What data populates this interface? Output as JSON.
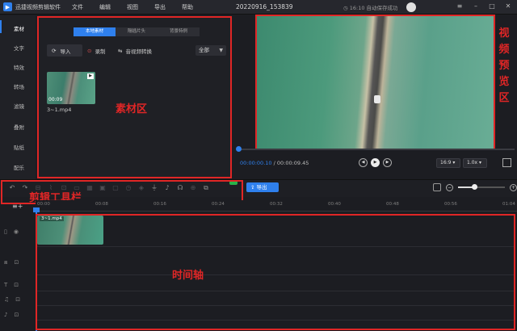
{
  "app": {
    "name": "迅捷视频剪辑软件",
    "document_title": "20220916_153839",
    "save_status": "16:10 自动保存成功"
  },
  "menu": [
    "文件",
    "编辑",
    "视图",
    "导出",
    "帮助"
  ],
  "sidebar": {
    "items": [
      {
        "label": "素材",
        "active": true
      },
      {
        "label": "文字"
      },
      {
        "label": "特效"
      },
      {
        "label": "转场"
      },
      {
        "label": "滤镜"
      },
      {
        "label": "叠附"
      },
      {
        "label": "贴纸"
      },
      {
        "label": "配乐"
      }
    ]
  },
  "media": {
    "tabs": [
      {
        "label": "本地素材",
        "active": true
      },
      {
        "label": "隔插片头"
      },
      {
        "label": "背景特例"
      }
    ],
    "import_label": "导入",
    "record_label": "录制",
    "convert_label": "音视频转换",
    "filter_value": "全部",
    "item": {
      "duration": "00:09",
      "name": "3~1.mp4"
    },
    "annotation": "素材区"
  },
  "preview": {
    "annotation": "视频预览区",
    "current_time": "00:00:00.10",
    "total_time": "00:00:09.45",
    "ratio": "16:9",
    "speed": "1.0x",
    "progress_fraction": 0.01
  },
  "toolbar": {
    "annotation": "剪辑工具栏",
    "export_label": "导出",
    "zoom_fraction": 0.35
  },
  "timeline": {
    "annotation": "时间轴",
    "ruler_ticks": [
      "00:00",
      "00:08",
      "00:16",
      "00:24",
      "00:32",
      "00:40",
      "00:48",
      "00:56",
      "01:04"
    ],
    "clip_name": "3~1.mp4"
  }
}
